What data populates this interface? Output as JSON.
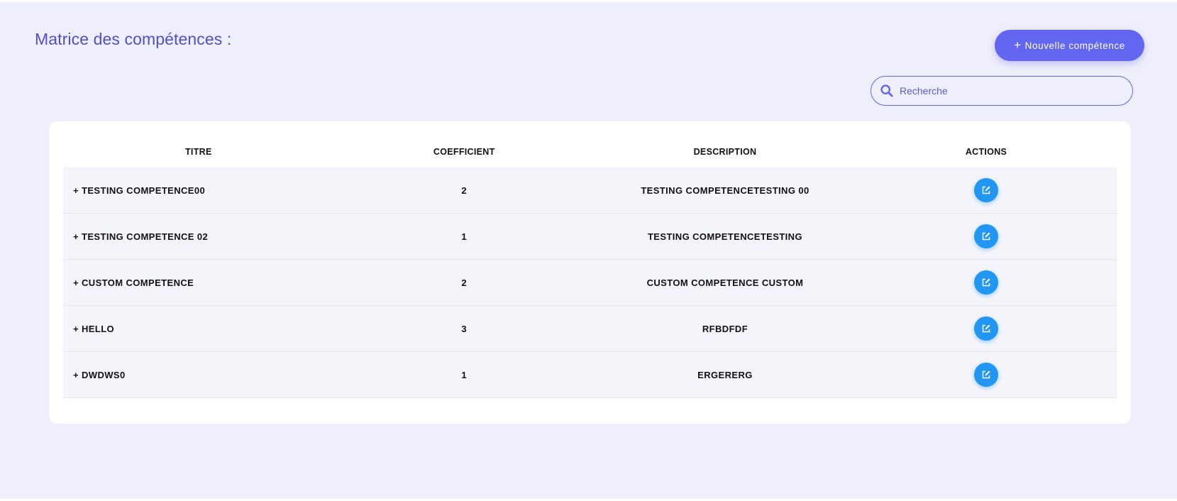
{
  "page": {
    "title": "Matrice des compétences :"
  },
  "toolbar": {
    "new_button_icon": "+",
    "new_button_label": "Nouvelle compétence"
  },
  "search": {
    "icon": "search-icon",
    "placeholder": "Recherche",
    "value": ""
  },
  "table": {
    "columns": {
      "titre": "TITRE",
      "coefficient": "COEFFICIENT",
      "description": "DESCRIPTION",
      "actions": "ACTIONS"
    },
    "rows": [
      {
        "titre": "+ TESTING COMPETENCE00",
        "coefficient": "2",
        "description": "TESTING COMPETENCETESTING 00",
        "action_icon": "edit-icon"
      },
      {
        "titre": "+ TESTING COMPETENCE 02",
        "coefficient": "1",
        "description": "TESTING COMPETENCETESTING",
        "action_icon": "edit-icon"
      },
      {
        "titre": "+ CUSTOM COMPETENCE",
        "coefficient": "2",
        "description": "CUSTOM COMPETENCE CUSTOM",
        "action_icon": "edit-icon"
      },
      {
        "titre": "+ HELLO",
        "coefficient": "3",
        "description": "RFBDFDF",
        "action_icon": "edit-icon"
      },
      {
        "titre": "+ DWDWS0",
        "coefficient": "1",
        "description": "ERGERERG",
        "action_icon": "edit-icon"
      }
    ]
  },
  "colors": {
    "page_background": "#efeffb",
    "title": "#4f4fd1",
    "primary_button": "#6366f1",
    "edit_button": "#2196f3",
    "row_background": "#f4f5fb"
  }
}
